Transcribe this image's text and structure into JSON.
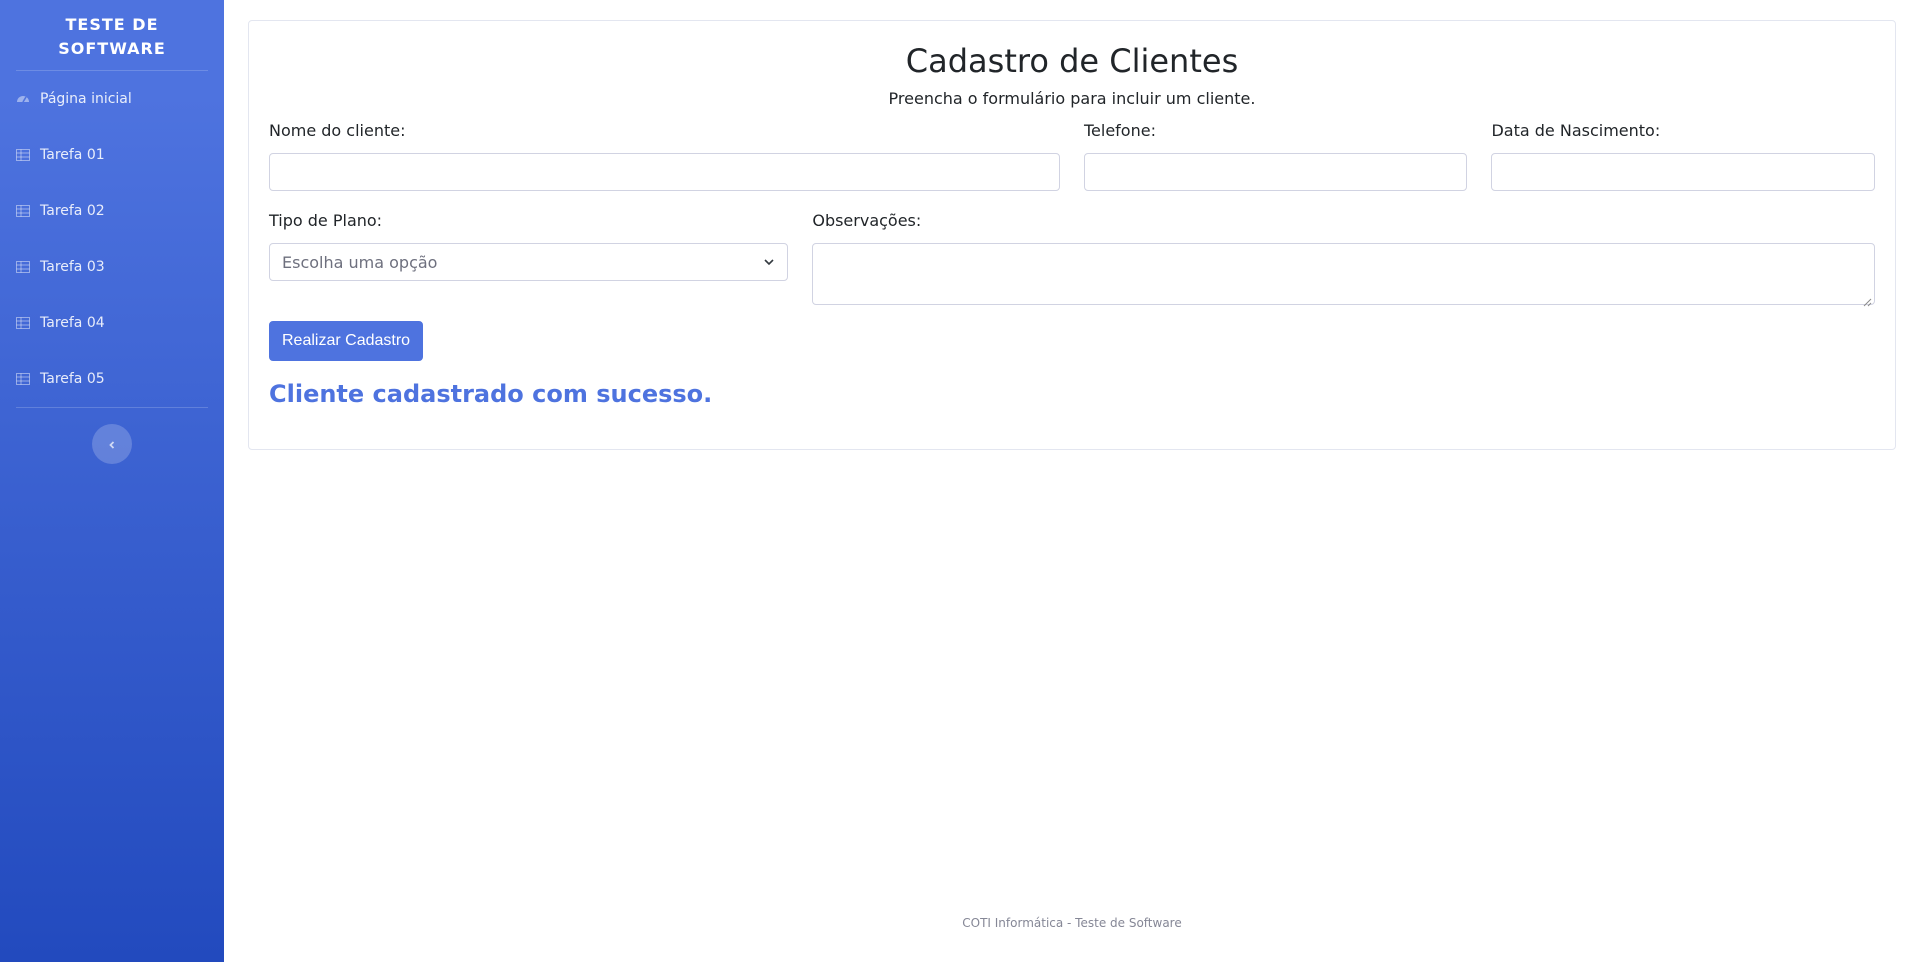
{
  "sidebar": {
    "brand": "TESTE DE SOFTWARE",
    "items": [
      {
        "label": "Página inicial",
        "icon": "tachometer-icon"
      },
      {
        "label": "Tarefa 01",
        "icon": "table-icon"
      },
      {
        "label": "Tarefa 02",
        "icon": "table-icon"
      },
      {
        "label": "Tarefa 03",
        "icon": "table-icon"
      },
      {
        "label": "Tarefa 04",
        "icon": "table-icon"
      },
      {
        "label": "Tarefa 05",
        "icon": "table-icon"
      }
    ],
    "toggle_icon": "chevron-left-icon"
  },
  "form": {
    "title": "Cadastro de Clientes",
    "subtitle": "Preencha o formulário para incluir um cliente.",
    "fields": {
      "nome": {
        "label": "Nome do cliente:",
        "value": ""
      },
      "telefone": {
        "label": "Telefone:",
        "value": ""
      },
      "nascimento": {
        "label": "Data de Nascimento:",
        "value": ""
      },
      "plano": {
        "label": "Tipo de Plano:",
        "selected": "Escolha uma opção"
      },
      "observacoes": {
        "label": "Observações:",
        "value": ""
      }
    },
    "submit_label": "Realizar Cadastro",
    "success_message": "Cliente cadastrado com sucesso."
  },
  "footer": {
    "text": "COTI Informática - Teste de Software"
  },
  "colors": {
    "primary": "#4e73df",
    "sidebar_gradient_end": "#224abe",
    "border": "#d1d3e2"
  }
}
